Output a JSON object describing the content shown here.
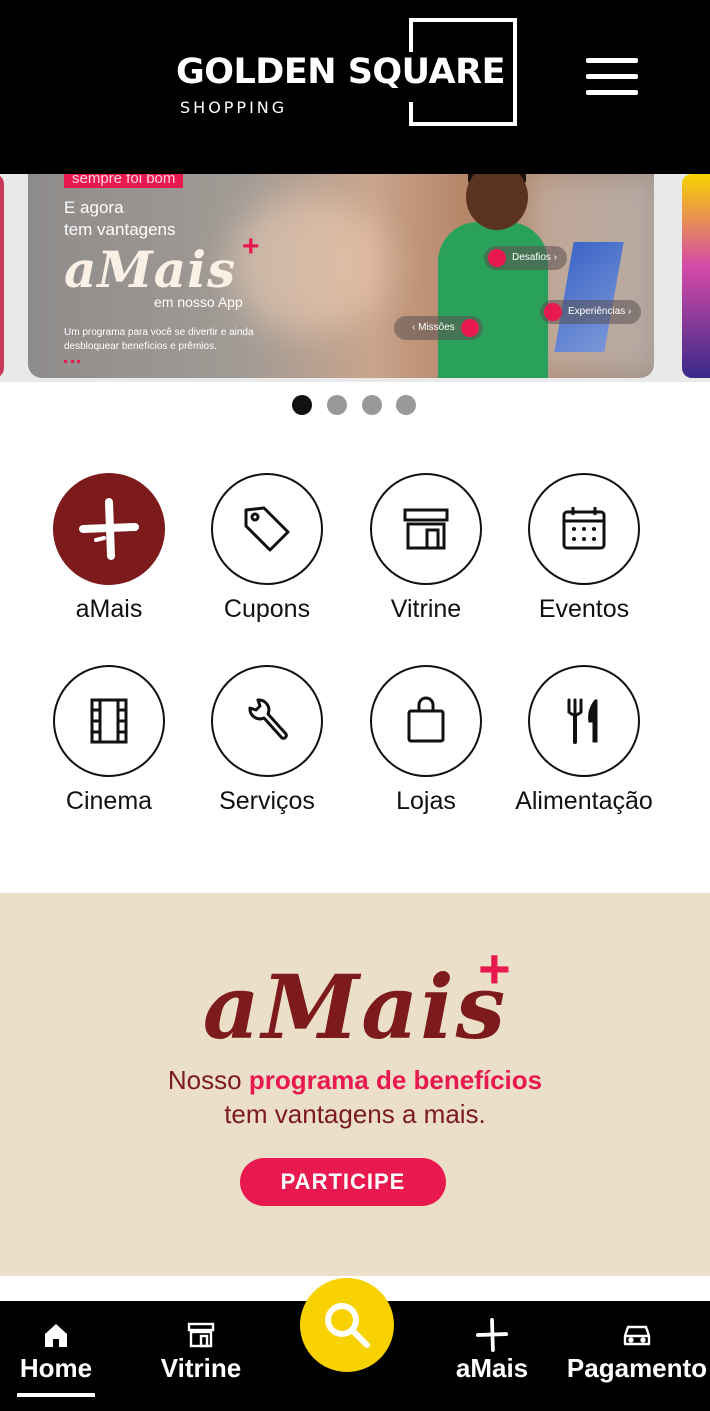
{
  "header": {
    "logo_name": "GOLDEN SQUARE",
    "logo_sub": "SHOPPING",
    "menu_icon": "hamburger-menu-icon"
  },
  "banner": {
    "tag": "sempre foi bom",
    "line1": "E agora",
    "line2": "tem vantagens",
    "brand": "aMais",
    "brand_plus": "+",
    "line3": "em nosso App",
    "line4": "Um programa para você se divertir e ainda desbloquear benefícios e prêmios.",
    "pills": [
      "Desafios",
      "Missões",
      "Experiências"
    ]
  },
  "carousel": {
    "dots": 4,
    "active_index": 0
  },
  "shortcuts": [
    {
      "label": "aMais",
      "icon": "amais-plus-icon",
      "active": true
    },
    {
      "label": "Cupons",
      "icon": "tag-icon",
      "active": false
    },
    {
      "label": "Vitrine",
      "icon": "storefront-icon",
      "active": false
    },
    {
      "label": "Eventos",
      "icon": "calendar-icon",
      "active": false
    },
    {
      "label": "Cinema",
      "icon": "film-strip-icon",
      "active": false
    },
    {
      "label": "Serviços",
      "icon": "wrench-icon",
      "active": false
    },
    {
      "label": "Lojas",
      "icon": "shopping-bag-icon",
      "active": false
    },
    {
      "label": "Alimentação",
      "icon": "fork-knife-icon",
      "active": false
    }
  ],
  "promo": {
    "brand": "aMais",
    "brand_plus": "+",
    "line1_prefix": "Nosso",
    "line1_highlight": "programa de benefícios",
    "line2": "tem vantagens a mais.",
    "button": "PARTICIPE"
  },
  "bottom_nav": {
    "items": [
      {
        "label": "Home",
        "icon": "home-icon",
        "active": true
      },
      {
        "label": "Vitrine",
        "icon": "storefront-icon",
        "active": false
      },
      {
        "label": "aMais",
        "icon": "amais-plus-icon",
        "active": false
      },
      {
        "label": "Pagamento",
        "icon": "car-icon",
        "active": false
      }
    ],
    "search_icon": "search-icon"
  },
  "colors": {
    "brand_dark_red": "#7c1a1c",
    "accent_pink": "#e8194f",
    "search_yellow": "#f8d200",
    "promo_bg": "#ebdfc9"
  }
}
